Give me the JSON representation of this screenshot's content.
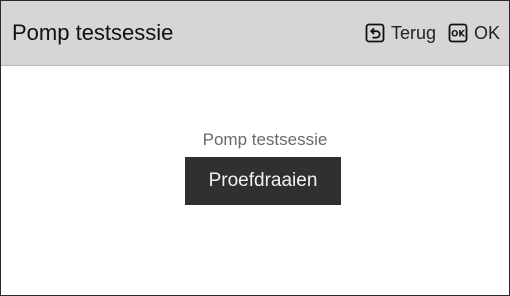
{
  "header": {
    "title": "Pomp testsessie",
    "back": {
      "icon": "back-icon",
      "label": "Terug"
    },
    "ok": {
      "icon": "ok-icon",
      "icon_text": "OK",
      "label": "OK"
    }
  },
  "main": {
    "caption": "Pomp testsessie",
    "selected_option": "Proefdraaien"
  },
  "colors": {
    "header_bg": "#d6d6d6",
    "button_bg": "#303030",
    "button_text": "#f2f2f2",
    "caption_text": "#6a6a6a"
  }
}
